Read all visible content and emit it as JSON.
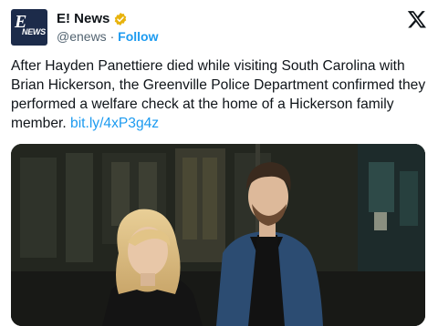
{
  "account": {
    "avatar_alt": "E! News logo",
    "logo_e": "E",
    "logo_news": "NEWS",
    "display_name": "E! News",
    "handle": "@enews",
    "separator": "·",
    "follow_label": "Follow"
  },
  "tweet": {
    "text": "After Hayden Panettiere died while visiting South Carolina with Brian Hickerson, the Greenville Police Department confirmed they performed a welfare check at the home of a Hickerson family member.",
    "link": "bit.ly/4xP3g4z"
  },
  "colors": {
    "link": "#1d9bf0",
    "verified_badge": "#e8b30d",
    "avatar_bg": "#1c2b4a",
    "secondary_text": "#536471"
  },
  "icons": {
    "verified": "verified-badge-icon",
    "brand": "x-logo-icon"
  }
}
